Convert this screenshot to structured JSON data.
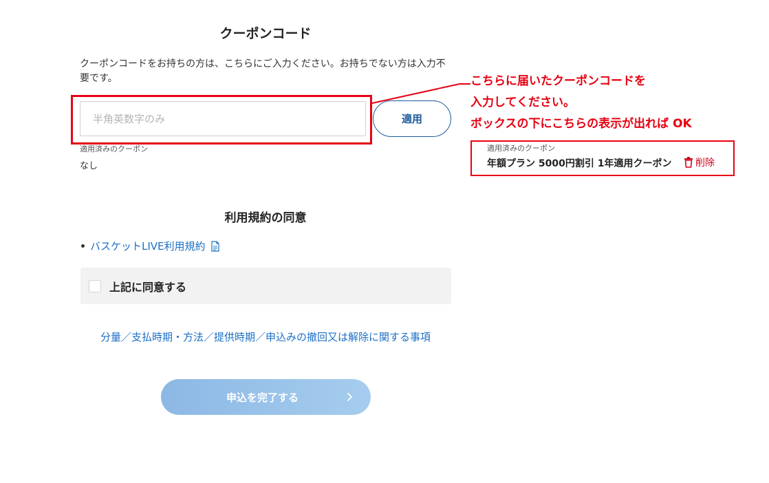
{
  "coupon": {
    "title": "クーポンコード",
    "description": "クーポンコードをお持ちの方は、こちらにご入力ください。お持ちでない方は入力不要です。",
    "input_placeholder": "半角英数字のみ",
    "input_value": "",
    "apply_label": "適用",
    "applied_label": "適用済みのクーポン",
    "applied_value": "なし"
  },
  "callout": {
    "line1": "こちらに届いたクーポンコードを",
    "line2": "入力してください。",
    "line3": "ボックスの下にこちらの表示が出れば OK",
    "sample_label": "適用済みのクーポン",
    "sample_coupon": "年額プラン 5000円割引 1年適用クーポン",
    "delete_label": "削除",
    "accent_color": "#e60012"
  },
  "terms": {
    "title": "利用規約の同意",
    "link_label": "バスケットLIVE利用規約",
    "agree_label": "上記に同意する",
    "agree_checked": false,
    "details_link": "分量／支払時期・方法／提供時期／申込みの撤回又は解除に関する事項"
  },
  "submit": {
    "label": "申込を完了する"
  },
  "icons": {
    "delete": "trash-icon",
    "terms_doc": "document-icon",
    "submit": "chevron-right-icon"
  }
}
